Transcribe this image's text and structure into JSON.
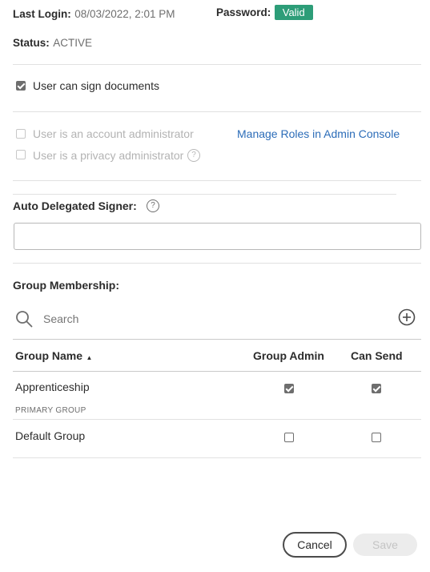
{
  "info": {
    "last_login_label": "Last Login:",
    "last_login_value": "08/03/2022, 2:01 PM",
    "password_label": "Password:",
    "password_badge": "Valid",
    "status_label": "Status:",
    "status_value": "ACTIVE"
  },
  "permissions": {
    "sign_documents": {
      "label": "User can sign documents",
      "checked": true
    },
    "account_admin": {
      "label": "User is an account administrator",
      "checked": false,
      "disabled": true
    },
    "privacy_admin": {
      "label": "User is a privacy administrator",
      "checked": false,
      "disabled": true
    },
    "manage_roles_link": "Manage Roles in Admin Console"
  },
  "delegated": {
    "label": "Auto Delegated Signer:",
    "value": ""
  },
  "groups": {
    "title": "Group Membership:",
    "search_placeholder": "Search",
    "columns": {
      "name": "Group Name",
      "admin": "Group Admin",
      "send": "Can Send"
    },
    "sort_indicator": "▲",
    "rows": [
      {
        "name": "Apprenticeship",
        "sub": "PRIMARY GROUP",
        "group_admin": true,
        "can_send": true
      },
      {
        "name": "Default Group",
        "sub": "",
        "group_admin": false,
        "can_send": false
      }
    ]
  },
  "footer": {
    "cancel": "Cancel",
    "save": "Save"
  },
  "colors": {
    "badge": "#2d9d78",
    "link": "#2b6cb8"
  }
}
